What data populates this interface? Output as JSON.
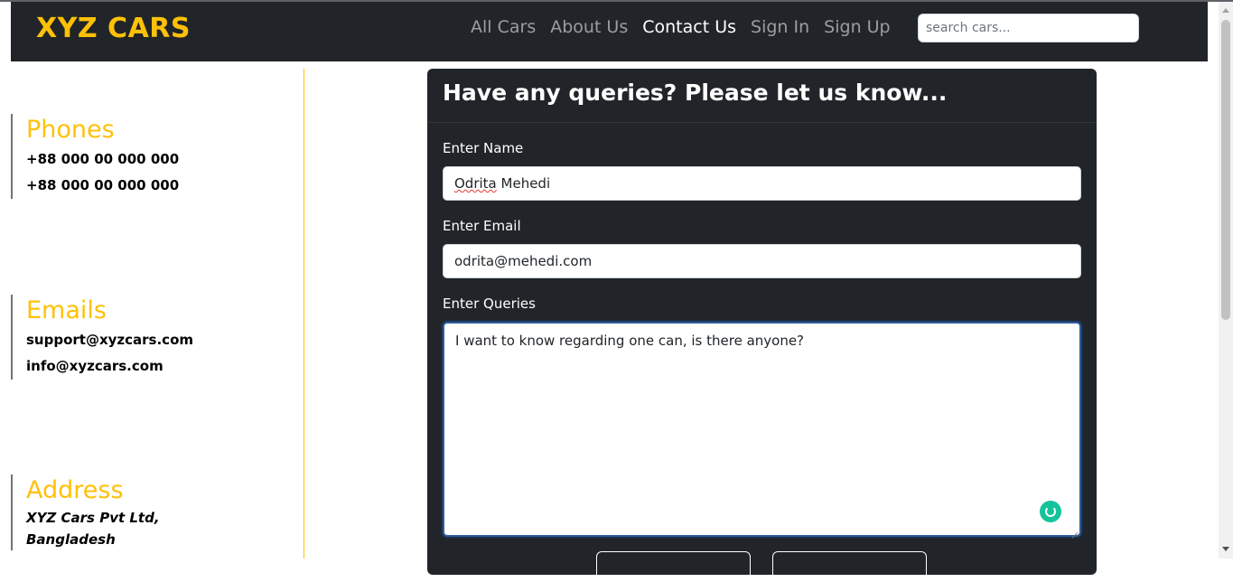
{
  "navbar": {
    "brand": "XYZ CARS",
    "links": [
      {
        "label": "All Cars"
      },
      {
        "label": "About Us"
      },
      {
        "label": "Contact Us"
      },
      {
        "label": "Sign In"
      },
      {
        "label": "Sign Up"
      }
    ],
    "search_placeholder": "search cars..."
  },
  "contact_info": {
    "phones": {
      "title": "Phones",
      "lines": [
        "+88 000 00 000 000",
        "+88 000 00 000 000"
      ]
    },
    "emails": {
      "title": "Emails",
      "lines": [
        "support@xyzcars.com",
        "info@xyzcars.com"
      ]
    },
    "address": {
      "title": "Address",
      "lines": [
        "XYZ Cars Pvt Ltd,",
        "Bangladesh"
      ]
    }
  },
  "form": {
    "heading": "Have any queries? Please let us know...",
    "name_label": "Enter Name",
    "name_value_first": "Odrita",
    "name_value_rest": " Mehedi",
    "email_label": "Enter Email",
    "email_value": "odrita@mehedi.com",
    "queries_label": "Enter Queries",
    "queries_value": "I want to know regarding one can, is there anyone?"
  },
  "colors": {
    "accent": "#ffc107",
    "navbar_bg": "#212529",
    "card_bg": "#212529"
  }
}
